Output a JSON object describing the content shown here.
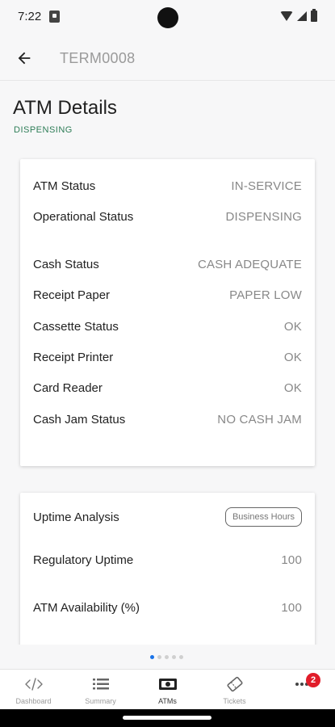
{
  "status_bar": {
    "time": "7:22"
  },
  "app_bar": {
    "title": "TERM0008"
  },
  "page": {
    "title": "ATM Details",
    "subtitle": "DISPENSING"
  },
  "details": [
    {
      "label": "ATM Status",
      "value": "IN-SERVICE"
    },
    {
      "label": "Operational Status",
      "value": "DISPENSING"
    },
    {
      "label": "Cash Status",
      "value": "CASH ADEQUATE"
    },
    {
      "label": "Receipt Paper",
      "value": "PAPER LOW"
    },
    {
      "label": "Cassette Status",
      "value": "OK"
    },
    {
      "label": "Receipt Printer",
      "value": "OK"
    },
    {
      "label": "Card Reader",
      "value": "OK"
    },
    {
      "label": "Cash Jam Status",
      "value": "NO CASH JAM"
    }
  ],
  "uptime": {
    "title": "Uptime Analysis",
    "filter": "Business Hours",
    "rows": [
      {
        "label": "Regulatory Uptime",
        "value": "100"
      },
      {
        "label": "ATM Availability (%)",
        "value": "100"
      }
    ]
  },
  "pager": {
    "count": 5,
    "active": 1
  },
  "nav": {
    "items": [
      {
        "label": "Dashboard",
        "icon": "code-icon"
      },
      {
        "label": "Summary",
        "icon": "list-icon"
      },
      {
        "label": "ATMs",
        "icon": "banknote-icon"
      },
      {
        "label": "Tickets",
        "icon": "ticket-icon"
      },
      {
        "label": "",
        "icon": "more-icon"
      }
    ],
    "active": "ATMs",
    "badge": "2"
  },
  "colors": {
    "accent": "#2e7d57",
    "badge": "#e11d2a",
    "pager_active": "#1a73e8"
  }
}
